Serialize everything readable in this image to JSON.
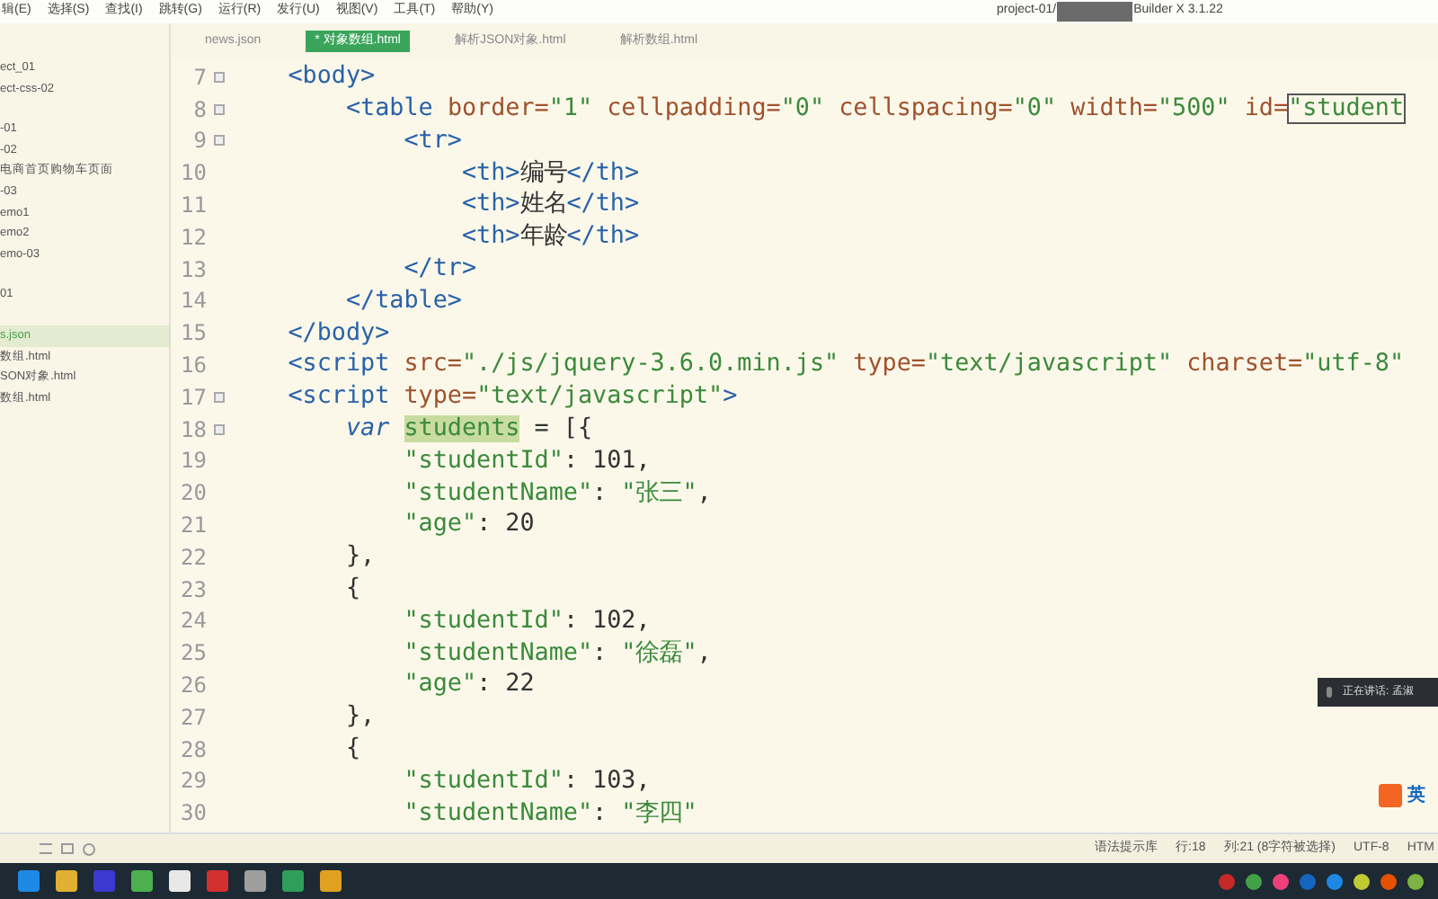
{
  "menu_bar": {
    "items": [
      "辑(E)",
      "选择(S)",
      "查找(I)",
      "跳转(G)",
      "运行(R)",
      "发行(U)",
      "视图(V)",
      "工具(T)",
      "帮助(Y)"
    ],
    "title_start": "project-01/",
    "title_end": "Builder X 3.1.22"
  },
  "tabs": [
    {
      "label": "news.json",
      "selected": false
    },
    {
      "label": "* 对象数组.html",
      "selected": true
    },
    {
      "label": "解析JSON对象.html",
      "selected": false
    },
    {
      "label": "解析数组.html",
      "selected": false
    }
  ],
  "sidebar": {
    "groups": [
      [
        {
          "label": "ect_01",
          "selected": false
        },
        {
          "label": "ect-css-02",
          "selected": false
        }
      ],
      [
        {
          "label": "-01",
          "selected": false
        },
        {
          "label": "-02",
          "selected": false
        },
        {
          "label": "电商首页购物车页面",
          "selected": false
        },
        {
          "label": "-03",
          "selected": false
        },
        {
          "label": "emo1",
          "selected": false
        },
        {
          "label": "emo2",
          "selected": false
        },
        {
          "label": "emo-03",
          "selected": false
        }
      ],
      [
        {
          "label": "01",
          "selected": false
        }
      ],
      [
        {
          "label": "s.json",
          "selected": true
        },
        {
          "label": "数组.html",
          "selected": false
        },
        {
          "label": "SON对象.html",
          "selected": false
        },
        {
          "label": "数组.html",
          "selected": false
        }
      ]
    ]
  },
  "editor": {
    "lines": [
      {
        "number": "7",
        "fold": true,
        "tokens": [
          {
            "kind": "tag",
            "text": "    <body>"
          }
        ]
      },
      {
        "number": "8",
        "fold": true,
        "tokens": [
          {
            "kind": "tag",
            "text": "        <table "
          },
          {
            "kind": "attr",
            "text": "border="
          },
          {
            "kind": "str",
            "text": "\"1\" "
          },
          {
            "kind": "attr",
            "text": "cellpadding="
          },
          {
            "kind": "str",
            "text": "\"0\" "
          },
          {
            "kind": "attr",
            "text": "cellspacing="
          },
          {
            "kind": "str",
            "text": "\"0\" "
          },
          {
            "kind": "attr",
            "text": "width="
          },
          {
            "kind": "str",
            "text": "\"500\" "
          },
          {
            "kind": "attr",
            "text": "id="
          },
          {
            "kind": "match",
            "text": "\"student"
          }
        ]
      },
      {
        "number": "9",
        "fold": true,
        "tokens": [
          {
            "kind": "tag",
            "text": "            <tr>"
          }
        ]
      },
      {
        "number": "10",
        "fold": false,
        "tokens": [
          {
            "kind": "tag",
            "text": "                <th>"
          },
          {
            "kind": "plain",
            "text": "编号"
          },
          {
            "kind": "tag",
            "text": "</th>"
          }
        ]
      },
      {
        "number": "11",
        "fold": false,
        "tokens": [
          {
            "kind": "tag",
            "text": "                <th>"
          },
          {
            "kind": "plain",
            "text": "姓名"
          },
          {
            "kind": "tag",
            "text": "</th>"
          }
        ]
      },
      {
        "number": "12",
        "fold": false,
        "tokens": [
          {
            "kind": "tag",
            "text": "                <th>"
          },
          {
            "kind": "plain",
            "text": "年龄"
          },
          {
            "kind": "tag",
            "text": "</th>"
          }
        ]
      },
      {
        "number": "13",
        "fold": false,
        "tokens": [
          {
            "kind": "tag",
            "text": "            </tr>"
          }
        ]
      },
      {
        "number": "14",
        "fold": false,
        "tokens": [
          {
            "kind": "tag",
            "text": "        </table>"
          }
        ]
      },
      {
        "number": "15",
        "fold": false,
        "tokens": [
          {
            "kind": "tag",
            "text": "    </body>"
          }
        ]
      },
      {
        "number": "16",
        "fold": false,
        "tokens": [
          {
            "kind": "tag",
            "text": "    <script "
          },
          {
            "kind": "attr",
            "text": "src="
          },
          {
            "kind": "str",
            "text": "\"./js/jquery-3.6.0.min.js\" "
          },
          {
            "kind": "attr",
            "text": "type="
          },
          {
            "kind": "str",
            "text": "\"text/javascript\" "
          },
          {
            "kind": "attr",
            "text": "charset="
          },
          {
            "kind": "str",
            "text": "\"utf-8\""
          }
        ]
      },
      {
        "number": "17",
        "fold": true,
        "tokens": [
          {
            "kind": "tag",
            "text": "    <script "
          },
          {
            "kind": "attr",
            "text": "type="
          },
          {
            "kind": "str",
            "text": "\"text/javascript\""
          },
          {
            "kind": "tag",
            "text": ">"
          }
        ]
      },
      {
        "number": "18",
        "fold": true,
        "tokens": [
          {
            "kind": "keyword",
            "text": "        var "
          },
          {
            "kind": "selected",
            "text": "students"
          },
          {
            "kind": "plain",
            "text": " = [{"
          }
        ]
      },
      {
        "number": "19",
        "fold": false,
        "tokens": [
          {
            "kind": "str",
            "text": "            \"studentId\""
          },
          {
            "kind": "plain",
            "text": ": 101,"
          }
        ]
      },
      {
        "number": "20",
        "fold": false,
        "tokens": [
          {
            "kind": "str",
            "text": "            \"studentName\""
          },
          {
            "kind": "plain",
            "text": ": "
          },
          {
            "kind": "str",
            "text": "\"张三\""
          },
          {
            "kind": "plain",
            "text": ","
          }
        ]
      },
      {
        "number": "21",
        "fold": false,
        "tokens": [
          {
            "kind": "str",
            "text": "            \"age\""
          },
          {
            "kind": "plain",
            "text": ": 20"
          }
        ]
      },
      {
        "number": "22",
        "fold": false,
        "tokens": [
          {
            "kind": "plain",
            "text": "        },"
          }
        ]
      },
      {
        "number": "23",
        "fold": false,
        "tokens": [
          {
            "kind": "plain",
            "text": "        {"
          }
        ]
      },
      {
        "number": "24",
        "fold": false,
        "tokens": [
          {
            "kind": "str",
            "text": "            \"studentId\""
          },
          {
            "kind": "plain",
            "text": ": 102,"
          }
        ]
      },
      {
        "number": "25",
        "fold": false,
        "tokens": [
          {
            "kind": "str",
            "text": "            \"studentName\""
          },
          {
            "kind": "plain",
            "text": ": "
          },
          {
            "kind": "str",
            "text": "\"徐磊\""
          },
          {
            "kind": "plain",
            "text": ","
          }
        ]
      },
      {
        "number": "26",
        "fold": false,
        "tokens": [
          {
            "kind": "str",
            "text": "            \"age\""
          },
          {
            "kind": "plain",
            "text": ": 22"
          }
        ]
      },
      {
        "number": "27",
        "fold": false,
        "tokens": [
          {
            "kind": "plain",
            "text": "        },"
          }
        ]
      },
      {
        "number": "28",
        "fold": false,
        "tokens": [
          {
            "kind": "plain",
            "text": "        {"
          }
        ]
      },
      {
        "number": "29",
        "fold": false,
        "tokens": [
          {
            "kind": "str",
            "text": "            \"studentId\""
          },
          {
            "kind": "plain",
            "text": ": 103,"
          }
        ]
      },
      {
        "number": "30",
        "fold": false,
        "tokens": [
          {
            "kind": "str",
            "text": "            \"studentName\""
          },
          {
            "kind": "plain",
            "text": ": "
          },
          {
            "kind": "str",
            "text": "\"李四\""
          }
        ]
      }
    ]
  },
  "speaking_toast": {
    "text": "正在讲话: 孟淑"
  },
  "input_method": {
    "label": "英"
  },
  "status_bar": {
    "items": [
      "语法提示库",
      "行:18",
      "列:21 (8字符被选择)",
      "UTF-8",
      "HTM"
    ]
  }
}
